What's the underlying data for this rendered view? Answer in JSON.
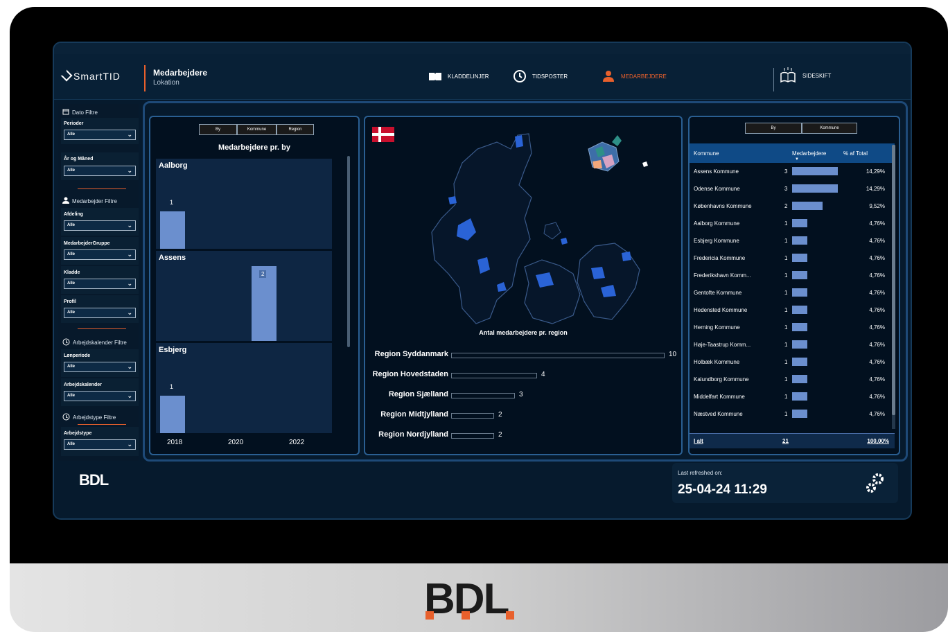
{
  "app": {
    "brand": "SmartTID",
    "title": "Medarbejdere",
    "subtitle": "Lokation"
  },
  "nav": [
    {
      "label": "KLADDELINJER",
      "icon": "book-icon"
    },
    {
      "label": "TIDSPOSTER",
      "icon": "clock-icon"
    },
    {
      "label": "MEDARBEJDERE",
      "icon": "person-icon",
      "active": true
    },
    {
      "label": "SIDESKIFT",
      "icon": "open-book-icon"
    }
  ],
  "sidebar": {
    "dato_title": "Dato Filtre",
    "medarbejder_title": "Medarbejder Filtre",
    "arbejdskalender_title": "Arbejdskalender Filtre",
    "arbejdstype_title": "Arbejdstype Filtre",
    "filters": {
      "perioder": {
        "label": "Perioder",
        "value": "Alle"
      },
      "aar_maaned": {
        "label": "År og Måned",
        "value": "Alle"
      },
      "afdeling": {
        "label": "Afdeling",
        "value": "Alle"
      },
      "gruppe": {
        "label": "MedarbejderGruppe",
        "value": "Alle"
      },
      "kladde": {
        "label": "Kladde",
        "value": "Alle"
      },
      "profil": {
        "label": "Profil",
        "value": "Alle"
      },
      "loenperiode": {
        "label": "Lønperiode",
        "value": "Alle"
      },
      "arbejdskalender": {
        "label": "Arbejdskalender",
        "value": "Alle"
      },
      "arbejdstype": {
        "label": "Arbejdstype",
        "value": "Alle"
      }
    }
  },
  "left_panel": {
    "segments": [
      "By",
      "Kommune",
      "Region"
    ],
    "title": "Medarbejdere pr. by",
    "cities": [
      {
        "name": "Aalborg",
        "year": 2018,
        "value": 1
      },
      {
        "name": "Assens",
        "year": 2021,
        "value": 2
      },
      {
        "name": "Esbjerg",
        "year": 2018,
        "value": 1
      }
    ],
    "x_ticks": [
      "2018",
      "2020",
      "2022"
    ]
  },
  "center_panel": {
    "title": "Antal medarbejdere pr. region",
    "regions": [
      {
        "name": "Region Syddanmark",
        "value": 10
      },
      {
        "name": "Region Hovedstaden",
        "value": 4
      },
      {
        "name": "Region Sjælland",
        "value": 3
      },
      {
        "name": "Region Midtjylland",
        "value": 2
      },
      {
        "name": "Region Nordjylland",
        "value": 2
      }
    ]
  },
  "right_panel": {
    "segments": [
      "By",
      "Kommune"
    ],
    "headers": [
      "Kommune",
      "Medarbejdere",
      "% af Total"
    ],
    "rows": [
      {
        "kommune": "Assens Kommune",
        "n": 3,
        "pct": "14,29%"
      },
      {
        "kommune": "Odense Kommune",
        "n": 3,
        "pct": "14,29%"
      },
      {
        "kommune": "Københavns Kommune",
        "n": 2,
        "pct": "9,52%"
      },
      {
        "kommune": "Aalborg Kommune",
        "n": 1,
        "pct": "4,76%"
      },
      {
        "kommune": "Esbjerg Kommune",
        "n": 1,
        "pct": "4,76%"
      },
      {
        "kommune": "Fredericia Kommune",
        "n": 1,
        "pct": "4,76%"
      },
      {
        "kommune": "Frederikshavn Komm...",
        "n": 1,
        "pct": "4,76%"
      },
      {
        "kommune": "Gentofte Kommune",
        "n": 1,
        "pct": "4,76%"
      },
      {
        "kommune": "Hedensted Kommune",
        "n": 1,
        "pct": "4,76%"
      },
      {
        "kommune": "Herning Kommune",
        "n": 1,
        "pct": "4,76%"
      },
      {
        "kommune": "Høje-Taastrup Komm...",
        "n": 1,
        "pct": "4,76%"
      },
      {
        "kommune": "Holbæk Kommune",
        "n": 1,
        "pct": "4,76%"
      },
      {
        "kommune": "Kalundborg Kommune",
        "n": 1,
        "pct": "4,76%"
      },
      {
        "kommune": "Middelfart Kommune",
        "n": 1,
        "pct": "4,76%"
      },
      {
        "kommune": "Næstved Kommune",
        "n": 1,
        "pct": "4,76%"
      }
    ],
    "total": {
      "label": "I alt",
      "n": "21",
      "pct": "100,00%"
    }
  },
  "footer": {
    "brand": "BDL",
    "refresh_label": "Last refreshed on:",
    "refresh_value": "25-04-24 11:29"
  },
  "colors": {
    "accent": "#e8602c",
    "bar": "#6b8fce",
    "map_highlight": "#2a63d6"
  }
}
